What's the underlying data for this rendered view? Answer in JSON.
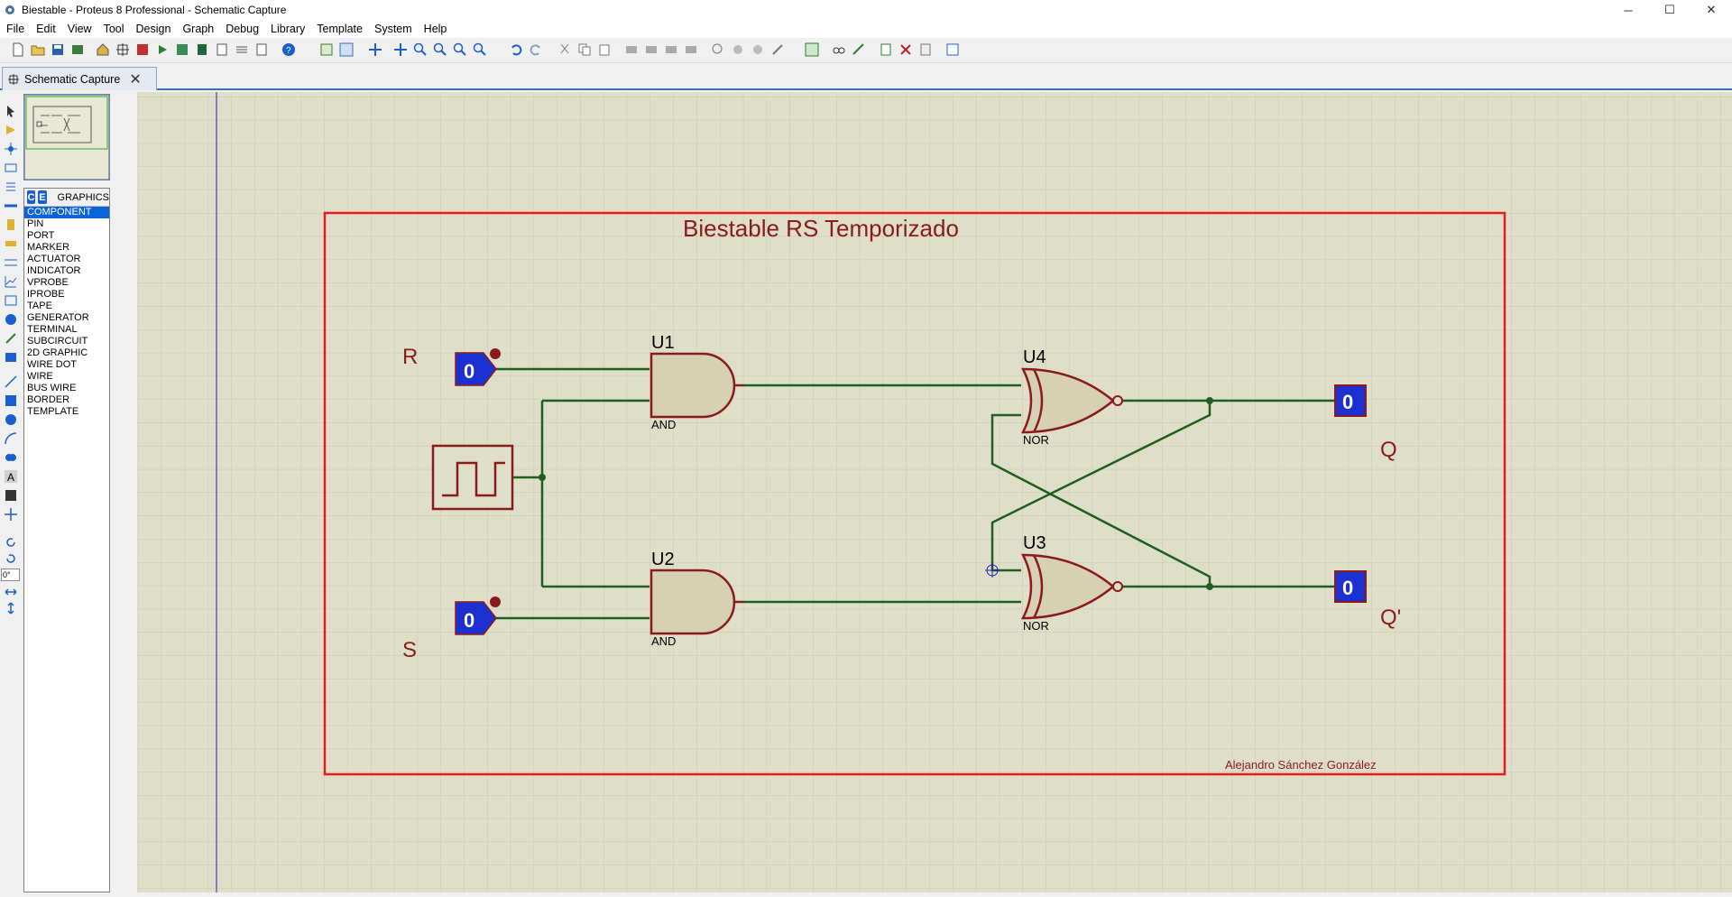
{
  "window": {
    "title": "Biestable - Proteus 8 Professional - Schematic Capture",
    "controls": [
      "─",
      "☐",
      "✕"
    ]
  },
  "menu": [
    "File",
    "Edit",
    "View",
    "Tool",
    "Design",
    "Graph",
    "Debug",
    "Library",
    "Template",
    "System",
    "Help"
  ],
  "tab": {
    "label": "Schematic Capture",
    "close": "✕"
  },
  "object_selector": {
    "buttons": [
      "C",
      "E"
    ],
    "title": "GRAPHICS",
    "items": [
      "COMPONENT",
      "PIN",
      "PORT",
      "MARKER",
      "ACTUATOR",
      "INDICATOR",
      "VPROBE",
      "IPROBE",
      "TAPE",
      "GENERATOR",
      "TERMINAL",
      "SUBCIRCUIT",
      "2D GRAPHIC",
      "WIRE DOT",
      "WIRE",
      "BUS WIRE",
      "BORDER",
      "TEMPLATE"
    ],
    "selected": "COMPONENT"
  },
  "rotation_field": "0°",
  "schematic": {
    "title": "Biestable RS Temporizado",
    "author": "Alejandro Sánchez González",
    "inputs": {
      "r_label": "R",
      "s_label": "S",
      "r_value": "0",
      "s_value": "0"
    },
    "outputs": {
      "q_label": "Q",
      "qn_label": "Q'",
      "q_value": "0",
      "qn_value": "0"
    },
    "gates": {
      "u1": {
        "ref": "U1",
        "type": "AND"
      },
      "u2": {
        "ref": "U2",
        "type": "AND"
      },
      "u3": {
        "ref": "U3",
        "type": "NOR"
      },
      "u4": {
        "ref": "U4",
        "type": "NOR"
      }
    },
    "colors": {
      "wire": "#1f5f1f",
      "component": "#8b1a1a",
      "border": "#e81c1c",
      "canvas": "#dfdfc9",
      "grid": "#c7c7b1",
      "logic_state": "#1c2fd0"
    }
  }
}
